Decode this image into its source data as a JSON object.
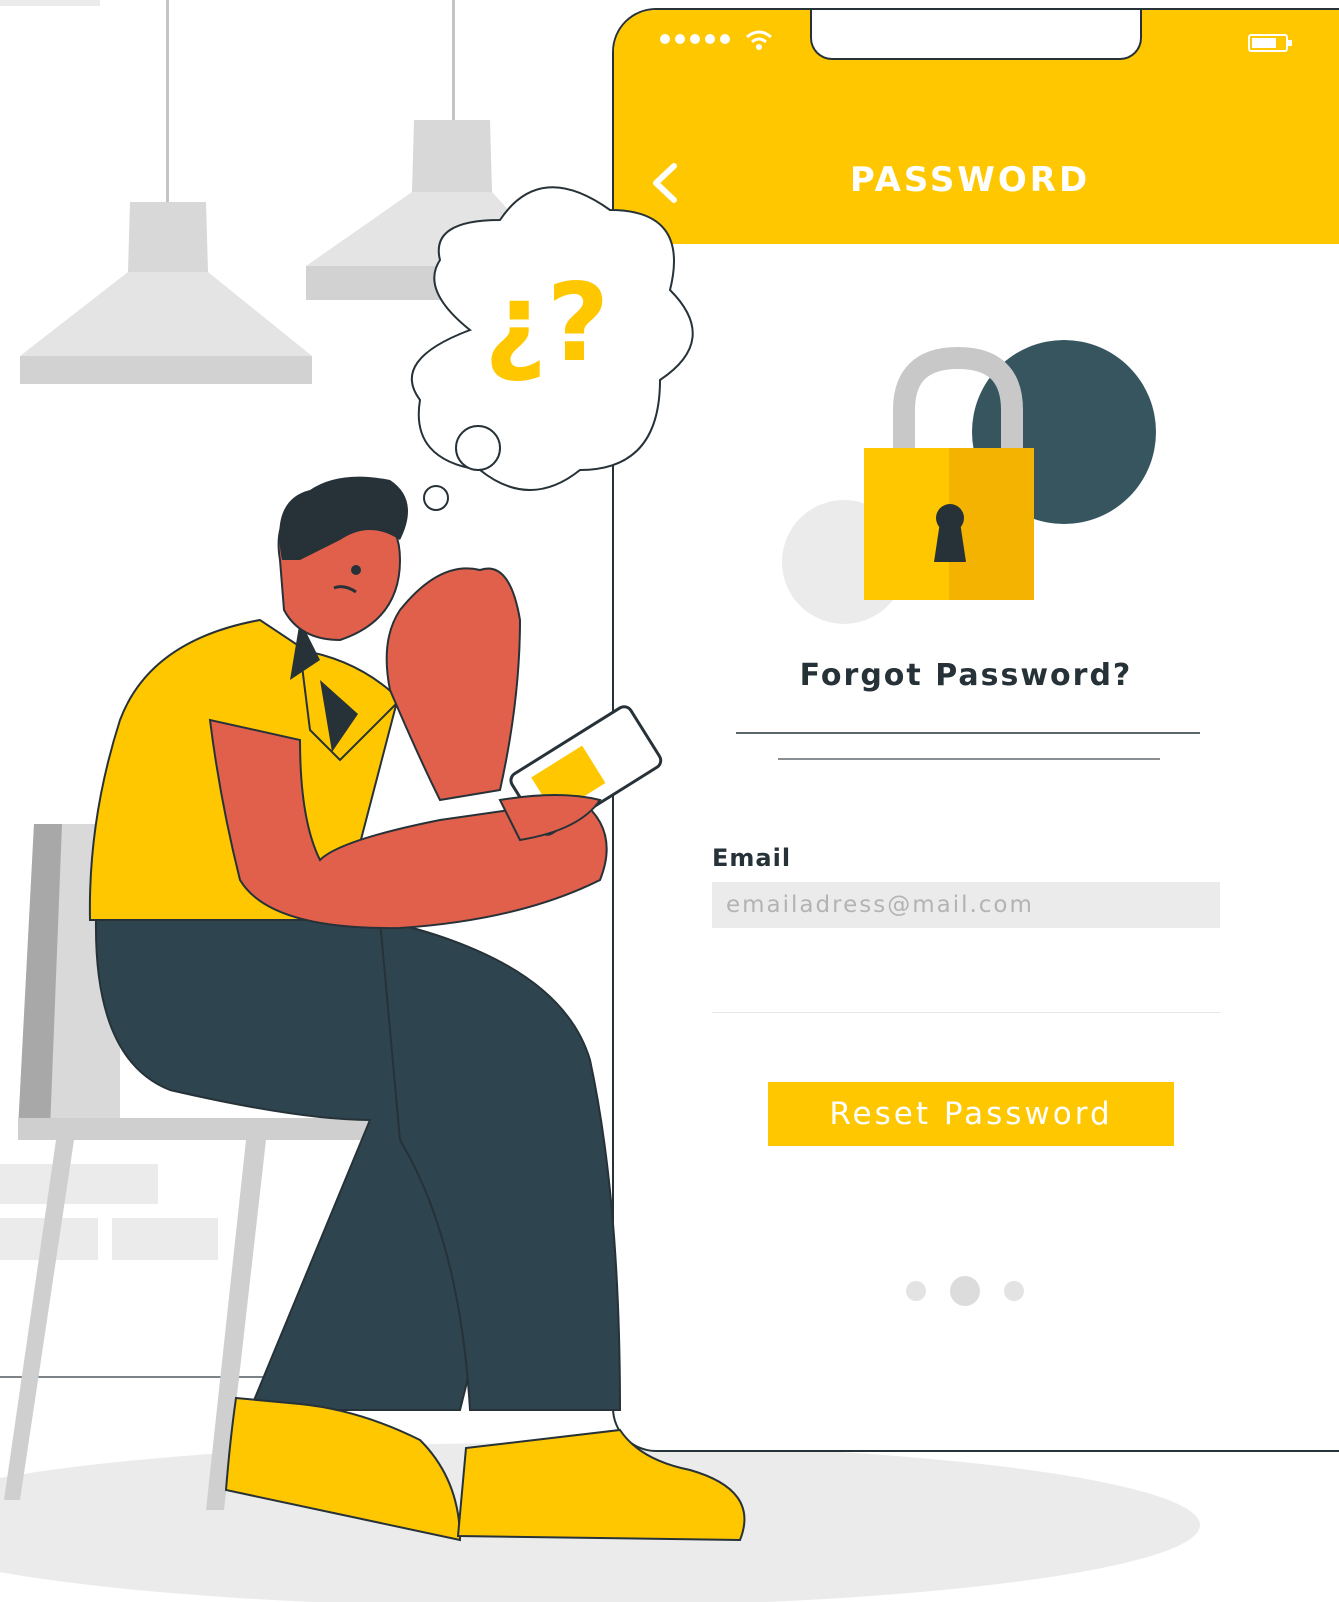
{
  "header": {
    "title": "PASSWORD"
  },
  "form": {
    "heading": "Forgot Password?",
    "email_label": "Email",
    "email_placeholder": "emailadress@mail.com",
    "reset_label": "Reset Password"
  },
  "pagination": {
    "total": 3,
    "active_index": 2
  },
  "thought_bubble": {
    "symbols": "¿?"
  },
  "colors": {
    "accent": "#FFC700",
    "dark": "#263238",
    "skin": "#E0604C",
    "pants": "#2E4550",
    "circle": "#37555F",
    "light_gray": "#EBEBEB"
  },
  "icons": [
    "signal-dots-icon",
    "wifi-icon",
    "battery-icon",
    "back-chevron-icon",
    "padlock-icon"
  ]
}
